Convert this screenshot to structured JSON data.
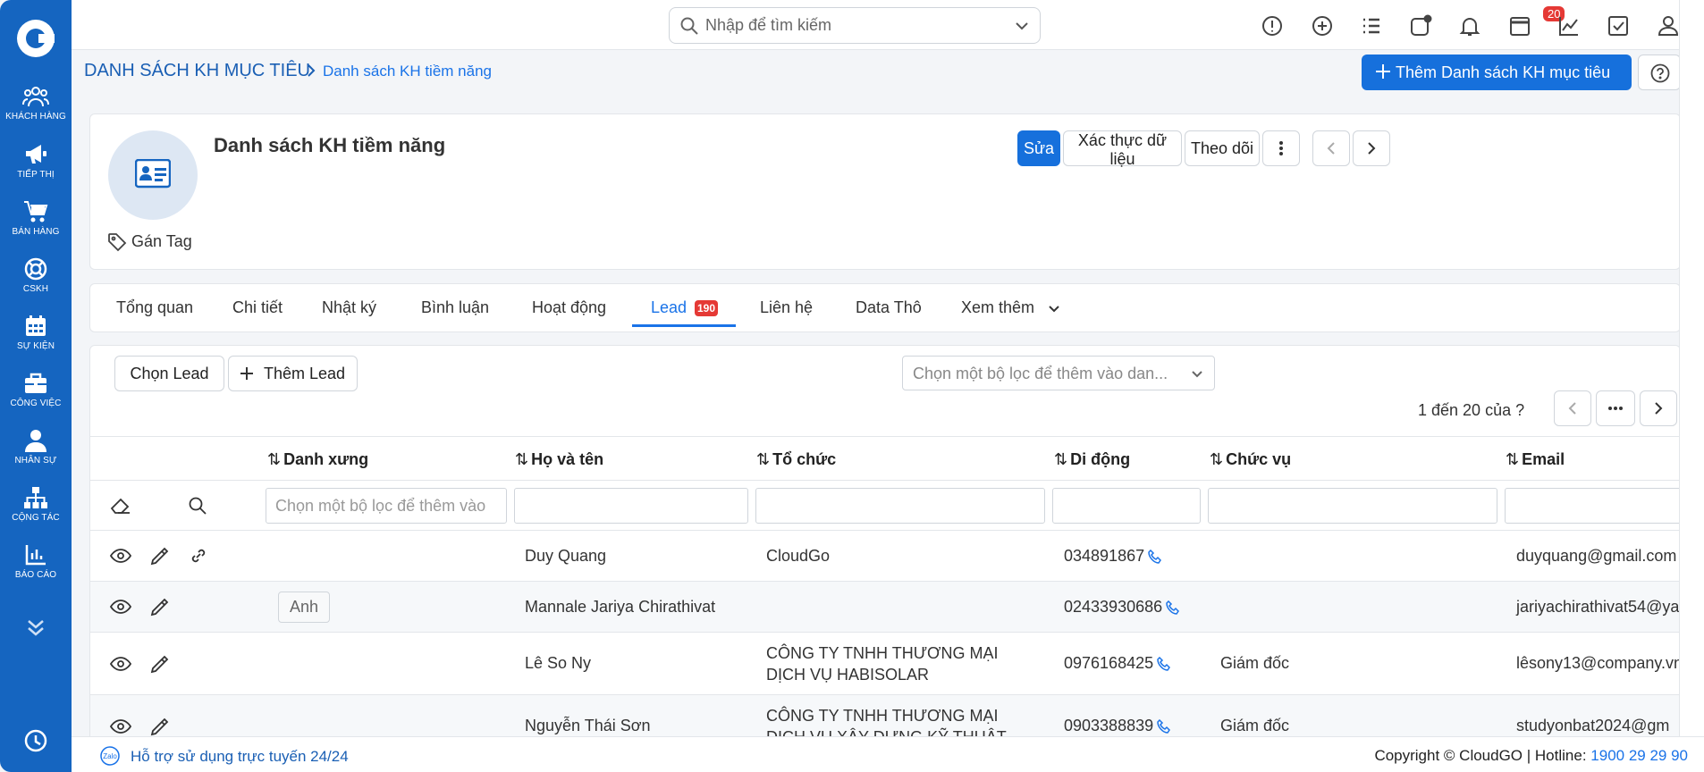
{
  "sidebar": {
    "items": [
      {
        "label": "KHÁCH HÀNG",
        "icon": "customers-icon"
      },
      {
        "label": "TIẾP THỊ",
        "icon": "megaphone-icon"
      },
      {
        "label": "BÁN HÀNG",
        "icon": "cart-icon"
      },
      {
        "label": "CSKH",
        "icon": "lifebuoy-icon"
      },
      {
        "label": "SỰ KIỆN",
        "icon": "calendar-icon"
      },
      {
        "label": "CÔNG VIỆC",
        "icon": "briefcase-icon"
      },
      {
        "label": "NHÂN SỰ",
        "icon": "person-icon"
      },
      {
        "label": "CỘNG TÁC",
        "icon": "org-chart-icon"
      },
      {
        "label": "BÁO CÁO",
        "icon": "report-icon"
      }
    ]
  },
  "topbar": {
    "search_placeholder": "Nhập để tìm kiếm",
    "notification_count": "20"
  },
  "breadcrumb": {
    "parent": "DANH SÁCH KH MỤC TIÊU",
    "current": "Danh sách KH tiềm năng"
  },
  "header": {
    "add_button": "Thêm Danh sách KH mục tiêu"
  },
  "record": {
    "title": "Danh sách KH tiềm năng",
    "tag_label": "Gán Tag",
    "actions": {
      "edit": "Sửa",
      "verify": "Xác thực dữ liệu",
      "follow": "Theo dõi"
    }
  },
  "tabs": [
    {
      "label": "Tổng quan"
    },
    {
      "label": "Chi tiết"
    },
    {
      "label": "Nhật ký"
    },
    {
      "label": "Bình luận"
    },
    {
      "label": "Hoạt động"
    },
    {
      "label": "Lead",
      "badge": "190",
      "active": true
    },
    {
      "label": "Liên hệ"
    },
    {
      "label": "Data Thô"
    },
    {
      "label": "Xem thêm"
    }
  ],
  "list": {
    "select_lead": "Chọn Lead",
    "add_lead": "Thêm Lead",
    "filter_placeholder": "Chọn một bộ lọc để thêm vào dan...",
    "pager_text": "1 đến 20 của ?",
    "columns": [
      "Danh xưng",
      "Họ và tên",
      "Tổ chức",
      "Di động",
      "Chức vụ",
      "Email"
    ],
    "salutation_filter_placeholder": "Chọn một bộ lọc để thêm vào",
    "rows": [
      {
        "salutation": "",
        "name": "Duy Quang",
        "org": "CloudGo",
        "mobile": "034891867",
        "title": "",
        "email": "duyquang@gmail.com"
      },
      {
        "salutation": "Anh",
        "name": "Mannale Jariya Chirathivat",
        "org": "",
        "mobile": "02433930686",
        "title": "",
        "email": "jariyachirathivat54@ya"
      },
      {
        "salutation": "",
        "name": "Lê So Ny",
        "org": "CÔNG TY TNHH THƯƠNG MẠI DỊCH VỤ HABISOLAR",
        "mobile": "0976168425",
        "title": "Giám đốc",
        "email": "lêsony13@company.vn"
      },
      {
        "salutation": "",
        "name": "Nguyễn Thái Sơn",
        "org": "CÔNG TY TNHH THƯƠNG MẠI DỊCH VỤ XÂY DỰNG KỸ THUẬT",
        "mobile": "0903388839",
        "title": "Giám đốc",
        "email": "studyonbat2024@gm"
      }
    ]
  },
  "footer": {
    "support": "Hỗ trợ sử dụng trực tuyến 24/24",
    "copyright": "Copyright © CloudGO",
    "hotline_label": "Hotline:",
    "hotline_number": "1900 29 29 90",
    "zalo": "Zalo"
  }
}
